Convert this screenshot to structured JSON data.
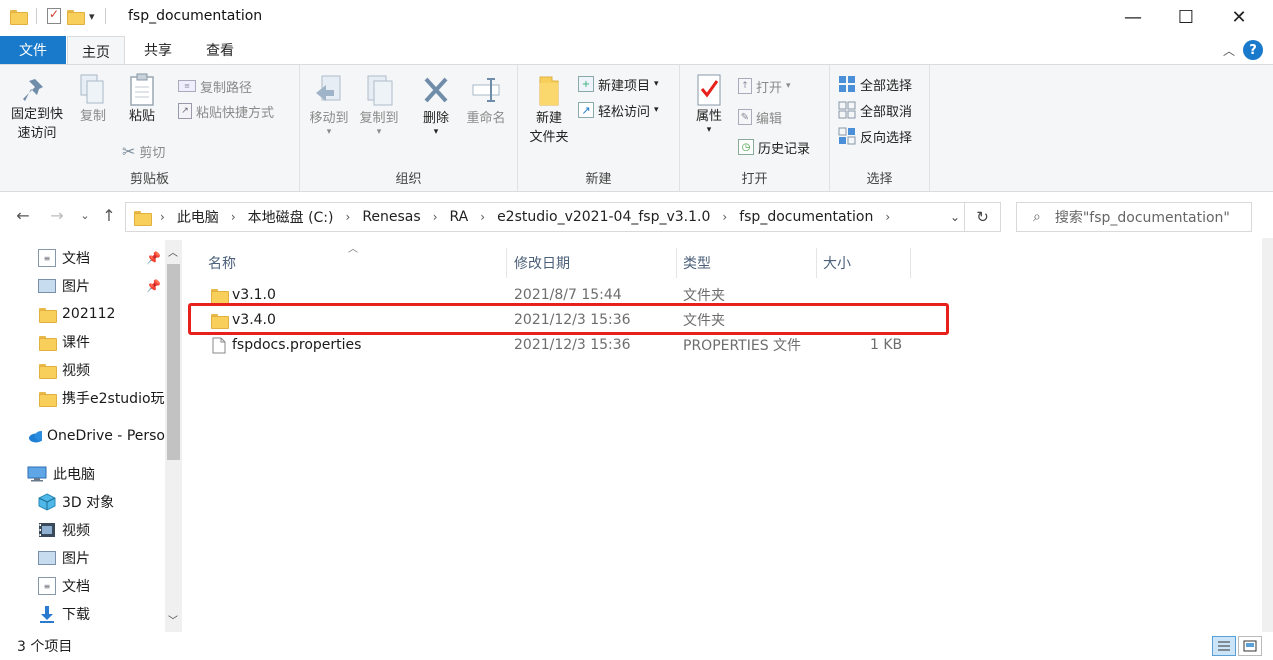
{
  "window": {
    "title": "fsp_documentation",
    "minimize": "—",
    "maximize": "☐",
    "close": "✕"
  },
  "tabs": {
    "file": "文件",
    "home": "主页",
    "share": "共享",
    "view": "查看"
  },
  "ribbon": {
    "clipboard": {
      "label": "剪贴板",
      "pin_label_line1": "固定到快",
      "pin_label_line2": "速访问",
      "copy": "复制",
      "paste": "粘贴",
      "copy_path": "复制路径",
      "paste_shortcut": "粘贴快捷方式",
      "cut": "剪切"
    },
    "organize": {
      "label": "组织",
      "move_to": "移动到",
      "copy_to": "复制到",
      "delete": "删除",
      "rename": "重命名"
    },
    "new": {
      "label": "新建",
      "new_folder_line1": "新建",
      "new_folder_line2": "文件夹",
      "new_item": "新建项目",
      "easy_access": "轻松访问"
    },
    "open": {
      "label": "打开",
      "properties": "属性",
      "open": "打开",
      "edit": "编辑",
      "history": "历史记录"
    },
    "select": {
      "label": "选择",
      "select_all": "全部选择",
      "select_none": "全部取消",
      "invert": "反向选择"
    }
  },
  "address": {
    "crumbs": [
      "此电脑",
      "本地磁盘 (C:)",
      "Renesas",
      "RA",
      "e2studio_v2021-04_fsp_v3.1.0",
      "fsp_documentation"
    ],
    "search_placeholder": "搜索\"fsp_documentation\""
  },
  "nav": {
    "items": [
      {
        "label": "文档",
        "icon": "documents-icon",
        "pinned": true
      },
      {
        "label": "图片",
        "icon": "pictures-icon",
        "pinned": true
      },
      {
        "label": "202112",
        "icon": "folder-icon",
        "pinned": false
      },
      {
        "label": "课件",
        "icon": "folder-icon",
        "pinned": false
      },
      {
        "label": "视频",
        "icon": "folder-icon",
        "pinned": false
      },
      {
        "label": "携手e2studio玩",
        "icon": "folder-icon",
        "pinned": false
      },
      {
        "label": "OneDrive - Perso",
        "icon": "onedrive-icon",
        "pinned": false
      },
      {
        "label": "此电脑",
        "icon": "this-pc-icon",
        "pinned": false
      },
      {
        "label": "3D 对象",
        "icon": "3d-objects-icon",
        "pinned": false
      },
      {
        "label": "视频",
        "icon": "videos-icon",
        "pinned": false
      },
      {
        "label": "图片",
        "icon": "pictures-icon",
        "pinned": false
      },
      {
        "label": "文档",
        "icon": "documents-icon",
        "pinned": false
      },
      {
        "label": "下载",
        "icon": "downloads-icon",
        "pinned": false
      }
    ]
  },
  "files": {
    "headers": {
      "name": "名称",
      "date": "修改日期",
      "type": "类型",
      "size": "大小"
    },
    "rows": [
      {
        "name": "v3.1.0",
        "date": "2021/8/7 15:44",
        "type": "文件夹",
        "size": "",
        "kind": "folder"
      },
      {
        "name": "v3.4.0",
        "date": "2021/12/3 15:36",
        "type": "文件夹",
        "size": "",
        "kind": "folder"
      },
      {
        "name": "fspdocs.properties",
        "date": "2021/12/3 15:36",
        "type": "PROPERTIES 文件",
        "size": "1 KB",
        "kind": "file"
      }
    ]
  },
  "status": {
    "count": "3 个项目"
  },
  "colors": {
    "accent": "#1979ca",
    "highlight": "#e8201c",
    "folder": "#f9cf5c"
  }
}
